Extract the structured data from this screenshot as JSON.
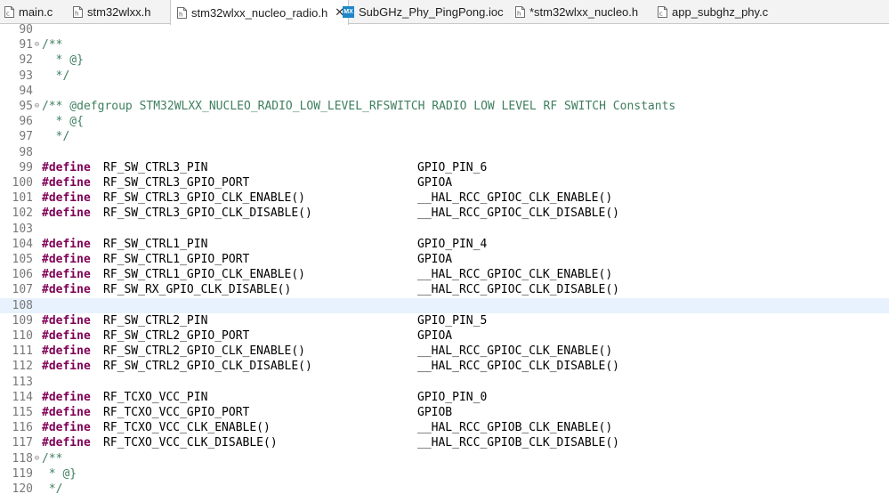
{
  "tabs": [
    {
      "label": "main.c",
      "icon": "c-file-icon",
      "active": false
    },
    {
      "label": "stm32wlxx.h",
      "icon": "h-file-icon",
      "active": false
    },
    {
      "label": "stm32wlxx_nucleo_radio.h",
      "icon": "h-file-icon",
      "active": true,
      "close": "✕"
    },
    {
      "label": "SubGHz_Phy_PingPong.ioc",
      "icon": "mx-icon",
      "icon_text": "MX",
      "active": false
    },
    {
      "label": "*stm32wlxx_nucleo.h",
      "icon": "h-file-icon",
      "active": false
    },
    {
      "label": "app_subghz_phy.c",
      "icon": "c-file-icon",
      "active": false
    }
  ],
  "editor": {
    "current_line": "108",
    "lines": [
      {
        "num": "90",
        "fold": "",
        "text": ""
      },
      {
        "num": "91",
        "fold": "⊖",
        "text": "/**"
      },
      {
        "num": "92",
        "fold": "",
        "text": "  * @}"
      },
      {
        "num": "93",
        "fold": "",
        "text": "  */"
      },
      {
        "num": "94",
        "fold": "",
        "text": ""
      },
      {
        "num": "95",
        "fold": "⊖",
        "text": "/** @defgroup STM32WLXX_NUCLEO_RADIO_LOW_LEVEL_RFSWITCH RADIO LOW LEVEL RF SWITCH Constants"
      },
      {
        "num": "96",
        "fold": "",
        "text": "  * @{"
      },
      {
        "num": "97",
        "fold": "",
        "text": "  */"
      },
      {
        "num": "98",
        "fold": "",
        "text": ""
      },
      {
        "num": "99",
        "fold": "",
        "kw": "#define",
        "name": "RF_SW_CTRL3_PIN",
        "value": "GPIO_PIN_6"
      },
      {
        "num": "100",
        "fold": "",
        "kw": "#define",
        "name": "RF_SW_CTRL3_GPIO_PORT",
        "value": "GPIOA"
      },
      {
        "num": "101",
        "fold": "",
        "kw": "#define",
        "name": "RF_SW_CTRL3_GPIO_CLK_ENABLE()",
        "value": "__HAL_RCC_GPIOC_CLK_ENABLE()"
      },
      {
        "num": "102",
        "fold": "",
        "kw": "#define",
        "name": "RF_SW_CTRL3_GPIO_CLK_DISABLE()",
        "value": "__HAL_RCC_GPIOC_CLK_DISABLE()"
      },
      {
        "num": "103",
        "fold": "",
        "text": ""
      },
      {
        "num": "104",
        "fold": "",
        "kw": "#define",
        "name": "RF_SW_CTRL1_PIN",
        "value": "GPIO_PIN_4"
      },
      {
        "num": "105",
        "fold": "",
        "kw": "#define",
        "name": "RF_SW_CTRL1_GPIO_PORT",
        "value": "GPIOA"
      },
      {
        "num": "106",
        "fold": "",
        "kw": "#define",
        "name": "RF_SW_CTRL1_GPIO_CLK_ENABLE()",
        "value": "__HAL_RCC_GPIOC_CLK_ENABLE()"
      },
      {
        "num": "107",
        "fold": "",
        "kw": "#define",
        "name": "RF_SW_RX_GPIO_CLK_DISABLE()",
        "value": "__HAL_RCC_GPIOC_CLK_DISABLE()"
      },
      {
        "num": "108",
        "fold": "",
        "text": ""
      },
      {
        "num": "109",
        "fold": "",
        "kw": "#define",
        "name": "RF_SW_CTRL2_PIN",
        "value": "GPIO_PIN_5"
      },
      {
        "num": "110",
        "fold": "",
        "kw": "#define",
        "name": "RF_SW_CTRL2_GPIO_PORT",
        "value": "GPIOA"
      },
      {
        "num": "111",
        "fold": "",
        "kw": "#define",
        "name": "RF_SW_CTRL2_GPIO_CLK_ENABLE()",
        "value": "__HAL_RCC_GPIOC_CLK_ENABLE()"
      },
      {
        "num": "112",
        "fold": "",
        "kw": "#define",
        "name": "RF_SW_CTRL2_GPIO_CLK_DISABLE()",
        "value": "__HAL_RCC_GPIOC_CLK_DISABLE()"
      },
      {
        "num": "113",
        "fold": "",
        "text": ""
      },
      {
        "num": "114",
        "fold": "",
        "kw": "#define",
        "name": "RF_TCXO_VCC_PIN",
        "value": "GPIO_PIN_0"
      },
      {
        "num": "115",
        "fold": "",
        "kw": "#define",
        "name": "RF_TCXO_VCC_GPIO_PORT",
        "value": "GPIOB"
      },
      {
        "num": "116",
        "fold": "",
        "kw": "#define",
        "name": "RF_TCXO_VCC_CLK_ENABLE()",
        "value": "__HAL_RCC_GPIOB_CLK_ENABLE()"
      },
      {
        "num": "117",
        "fold": "",
        "kw": "#define",
        "name": "RF_TCXO_VCC_CLK_DISABLE()",
        "value": "__HAL_RCC_GPIOB_CLK_DISABLE()"
      },
      {
        "num": "118",
        "fold": "⊖",
        "text": "/**"
      },
      {
        "num": "119",
        "fold": "",
        "text": " * @}"
      },
      {
        "num": "120",
        "fold": "",
        "text": " */"
      }
    ]
  }
}
